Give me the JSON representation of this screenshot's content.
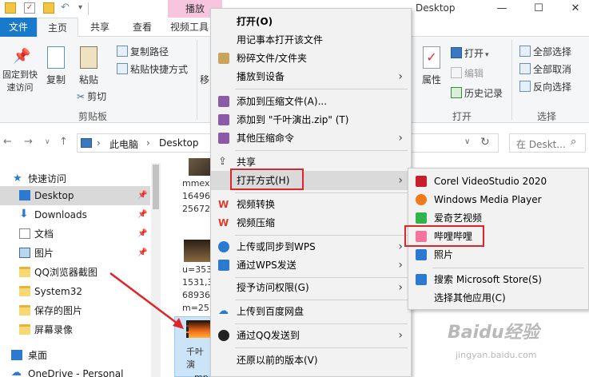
{
  "titlebar": {
    "play_tab": "播放",
    "title": "Desktop",
    "min": "—",
    "max": "☐",
    "close": "✕"
  },
  "ribbon_tabs": {
    "file": "文件",
    "home": "主页",
    "share": "共享",
    "view": "查看",
    "video_tools": "视频工具"
  },
  "ribbon": {
    "pin_quick": "固定到快\n速访问",
    "copy": "复制",
    "paste": "粘贴",
    "copy_path": "复制路径",
    "paste_shortcut": "粘贴快捷方式",
    "cut": "剪切",
    "clipboard_group": "剪贴板",
    "move_to": "移",
    "properties": "属性",
    "open": "打开",
    "edit": "编辑",
    "history": "历史记录",
    "open_group": "打开",
    "select_all": "全部选择",
    "select_none": "全部取消",
    "invert_selection": "反向选择",
    "select_group": "选择"
  },
  "address": {
    "segments": [
      "此电脑",
      "Desktop"
    ],
    "search_placeholder": "在 Deskt..."
  },
  "nav": {
    "items": [
      {
        "label": "快速访问"
      },
      {
        "label": "Desktop"
      },
      {
        "label": "Downloads"
      },
      {
        "label": "文档"
      },
      {
        "label": "图片"
      },
      {
        "label": "QQ浏览器截图"
      },
      {
        "label": "System32"
      },
      {
        "label": "保存的图片"
      },
      {
        "label": "屏幕录像"
      },
      {
        "label": "桌面"
      },
      {
        "label": "OneDrive - Personal"
      }
    ]
  },
  "files": {
    "file1_lines": [
      "mmexp",
      "16496",
      "25672"
    ],
    "file2_lines": [
      "u=353",
      "1531,3",
      "68936",
      "m=25"
    ],
    "file3_lines": [
      "千叶演",
      "mp"
    ]
  },
  "context_menu": {
    "items": [
      {
        "label": "打开(O)"
      },
      {
        "label": "用记事本打开该文件"
      },
      {
        "label": "粉碎文件/文件夹"
      },
      {
        "label": "播放到设备"
      },
      {
        "label": "添加到压缩文件(A)..."
      },
      {
        "label": "添加到 \"千叶演出.zip\" (T)"
      },
      {
        "label": "其他压缩命令"
      },
      {
        "label": "共享"
      },
      {
        "label": "打开方式(H)"
      },
      {
        "label": "视频转换"
      },
      {
        "label": "视频压缩"
      },
      {
        "label": "上传或同步到WPS"
      },
      {
        "label": "通过WPS发送"
      },
      {
        "label": "授予访问权限(G)"
      },
      {
        "label": "上传到百度网盘"
      },
      {
        "label": "通过QQ发送到"
      },
      {
        "label": "还原以前的版本(V)"
      }
    ]
  },
  "submenu": {
    "items": [
      {
        "label": "Corel VideoStudio 2020"
      },
      {
        "label": "Windows Media Player"
      },
      {
        "label": "爱奇艺视频"
      },
      {
        "label": "哔哩哔哩"
      },
      {
        "label": "照片"
      },
      {
        "label": "搜索 Microsoft Store(S)"
      },
      {
        "label": "选择其他应用(C)"
      }
    ]
  },
  "watermark": {
    "text": "Baidu经验",
    "url": "jingyan.baidu.com"
  },
  "colors": {
    "accent": "#1979ca",
    "highlight_red": "#e0242a",
    "play_tab_pink": "#f7c6de"
  }
}
